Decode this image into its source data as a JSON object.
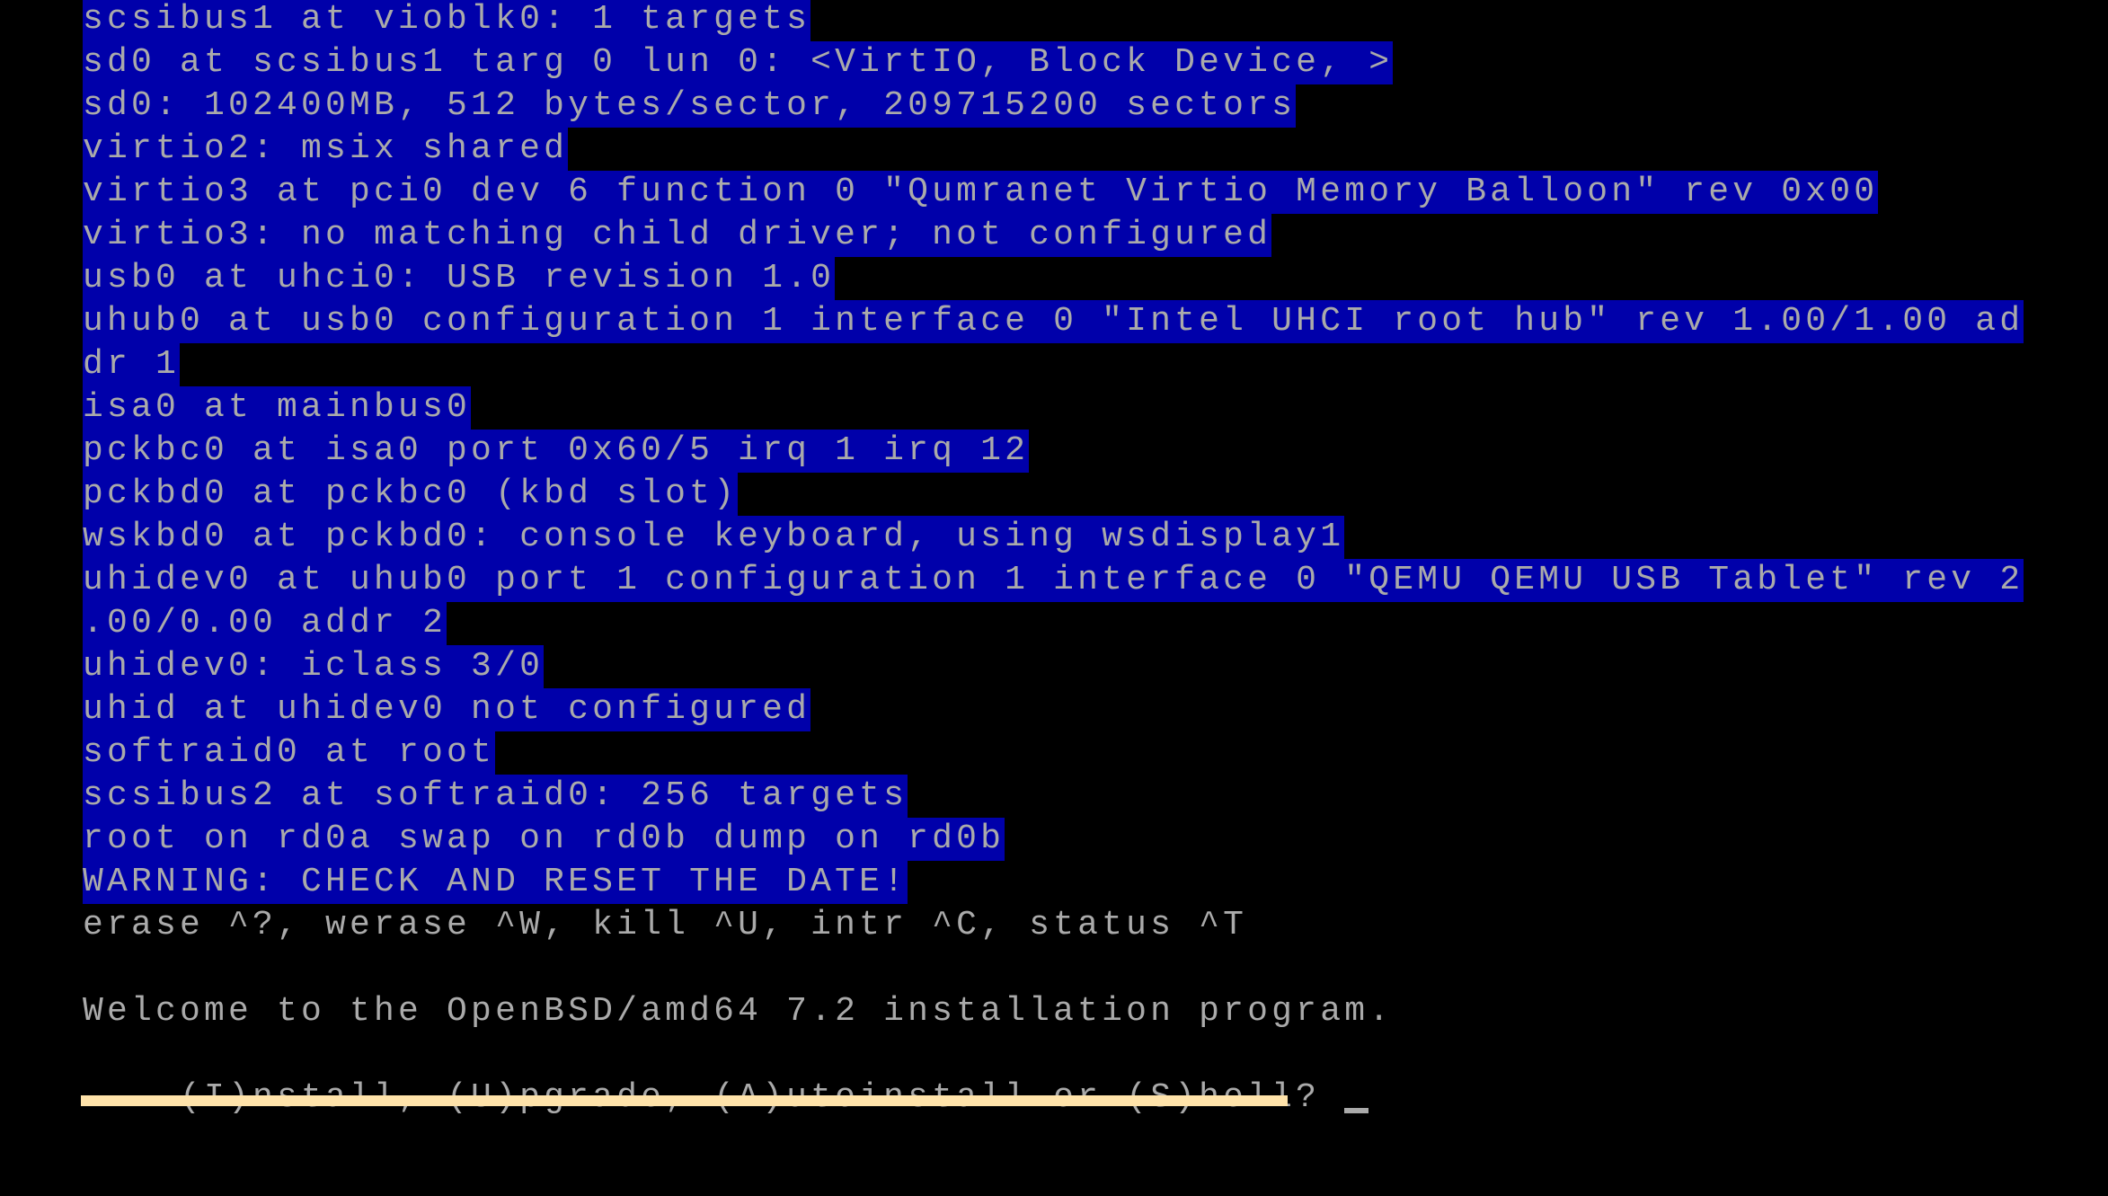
{
  "screen": {
    "type": "text-console",
    "colors": {
      "background": "#000000",
      "text": "#AAAAAA",
      "selection_highlight": "#0000AA",
      "progress_bar": "#FFE3AA"
    }
  },
  "console": {
    "highlighted_lines": [
      "scsibus1 at vioblk0: 1 targets",
      "sd0 at scsibus1 targ 0 lun 0: <VirtIO, Block Device, >",
      "sd0: 102400MB, 512 bytes/sector, 209715200 sectors",
      "virtio2: msix shared",
      "virtio3 at pci0 dev 6 function 0 \"Qumranet Virtio Memory Balloon\" rev 0x00",
      "virtio3: no matching child driver; not configured",
      "usb0 at uhci0: USB revision 1.0",
      "uhub0 at usb0 configuration 1 interface 0 \"Intel UHCI root hub\" rev 1.00/1.00 ad",
      "dr 1",
      "isa0 at mainbus0",
      "pckbc0 at isa0 port 0x60/5 irq 1 irq 12",
      "pckbd0 at pckbc0 (kbd slot)",
      "wskbd0 at pckbd0: console keyboard, using wsdisplay1",
      "uhidev0 at uhub0 port 1 configuration 1 interface 0 \"QEMU QEMU USB Tablet\" rev 2",
      ".00/0.00 addr 2",
      "uhidev0: iclass 3/0",
      "uhid at uhidev0 not configured",
      "softraid0 at root",
      "scsibus2 at softraid0: 256 targets",
      "root on rd0a swap on rd0b dump on rd0b",
      "WARNING: CHECK AND RESET THE DATE!"
    ],
    "plain_lines": [
      "erase ^?, werase ^W, kill ^U, intr ^C, status ^T",
      "",
      "Welcome to the OpenBSD/amd64 7.2 installation program."
    ],
    "prompt": {
      "text": "(I)nstall, (U)pgrade, (A)utoinstall or (S)hell? ",
      "input_value": "",
      "cursor_glyph": "_"
    }
  },
  "progress": {
    "label": "",
    "fraction": 1.0
  }
}
